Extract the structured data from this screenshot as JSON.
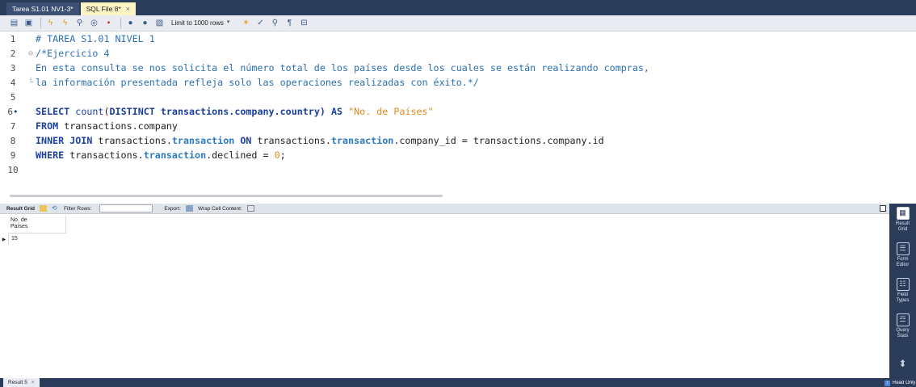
{
  "tabs": [
    {
      "label": "Tarea S1.01 NV1-3*",
      "active": false
    },
    {
      "label": "SQL File 8*",
      "active": true,
      "close": "×"
    }
  ],
  "toolbar": {
    "limit_label": "Limit to 1000 rows"
  },
  "editor": {
    "line_numbers": [
      "1",
      "2",
      "3",
      "4",
      "5",
      "6",
      "7",
      "8",
      "9",
      "10"
    ],
    "fold_glyph": "⊖",
    "exec_marker": "•",
    "line1": "# TAREA S1.01 NIVEL 1",
    "line2": "/*Ejercicio 4",
    "line3": "En esta consulta se nos solicita el número total de los países desde los cuales se están realizando compras,",
    "line4": "la información presentada refleja solo las operaciones realizadas con éxito.*/",
    "line6": {
      "kw1": "SELECT",
      "fn": "count",
      "p1": "(",
      "kw2": "DISTINCT",
      "expr": " transactions.company.country) ",
      "kw3": "AS",
      "str": "\"No. de Países\""
    },
    "line7": {
      "kw": "FROM",
      "rest": " transactions.company"
    },
    "line8": {
      "kw1": "INNER JOIN",
      "a": " transactions.",
      "t1": "transaction",
      "kw2": " ON",
      "b": " transactions.",
      "t2": "transaction",
      "c": ".company_id = transactions.company.id"
    },
    "line9": {
      "kw": "WHERE",
      "a": " transactions.",
      "t": "transaction",
      "b": ".declined = ",
      "num": "0",
      "end": ";"
    }
  },
  "results": {
    "toolbar": {
      "result_grid": "Result Grid",
      "filter_rows": "Filter Rows:",
      "export": "Export:",
      "wrap": "Wrap Cell Content:"
    },
    "column_header": "No. de Países",
    "column_header_line1": "No. de",
    "column_header_line2": "Países",
    "row_arrow": "▶",
    "value": "15"
  },
  "side_panel": {
    "items": [
      {
        "label1": "Result",
        "label2": "Grid"
      },
      {
        "label1": "Form",
        "label2": "Editor"
      },
      {
        "label1": "Field",
        "label2": "Types"
      },
      {
        "label1": "Query",
        "label2": "Stats"
      }
    ]
  },
  "bottom": {
    "tab_label": "Result 5",
    "close": "×",
    "readonly": "Read Only"
  },
  "colors": {
    "chrome": "#2b3b5a",
    "keyword": "#1a3f9e",
    "comment": "#2a6fb0",
    "string": "#e08a1e"
  }
}
